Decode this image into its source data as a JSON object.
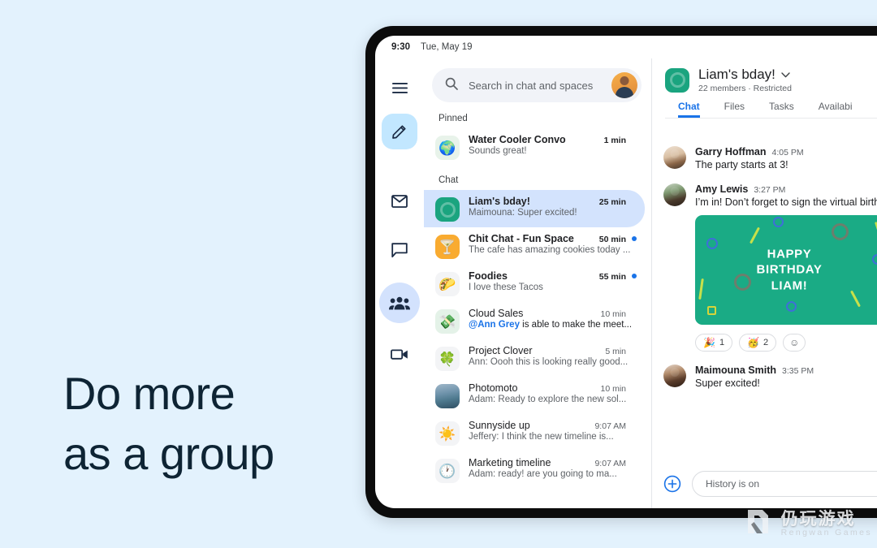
{
  "marketing": {
    "headline_line1": "Do more",
    "headline_line2": "as a group",
    "bg_color": "#e3f2fd",
    "text_color": "#0e2434"
  },
  "statusbar": {
    "time": "9:30",
    "date": "Tue, May 19"
  },
  "rail": {
    "items": [
      {
        "icon": "hamburger-menu-icon",
        "label": "Main menu"
      },
      {
        "icon": "compose-pencil-icon",
        "label": "Compose",
        "active": true
      },
      {
        "icon": "mail-icon",
        "label": "Mail"
      },
      {
        "icon": "chat-bubble-icon",
        "label": "Chat"
      },
      {
        "icon": "spaces-people-icon",
        "label": "Spaces",
        "active": true
      },
      {
        "icon": "video-camera-icon",
        "label": "Meet"
      }
    ]
  },
  "search": {
    "placeholder": "Search in chat and spaces",
    "icon": "search-icon",
    "avatar": "user-account-avatar"
  },
  "list": {
    "pinned_label": "Pinned",
    "chat_label": "Chat",
    "pinned": [
      {
        "avatar": "globe-emoji",
        "avatar_emoji": "🌍",
        "avatar_style": "globe",
        "name": "Water Cooler Convo",
        "preview": "Sounds great!",
        "time": "1 min",
        "bold": true,
        "unread": false
      }
    ],
    "chats": [
      {
        "avatar": "space-teal-icon",
        "avatar_emoji": "",
        "avatar_style": "teal",
        "name": "Liam's bday!",
        "preview": "Maimouna: Super excited!",
        "time": "25 min",
        "bold": true,
        "unread": false,
        "selected": true
      },
      {
        "avatar": "cocktail-emoji",
        "avatar_emoji": "🍸",
        "avatar_style": "amber",
        "name": "Chit Chat - Fun Space",
        "preview": "The cafe has amazing cookies today ...",
        "time": "50 min",
        "bold": true,
        "unread": true
      },
      {
        "avatar": "taco-emoji",
        "avatar_emoji": "🌮",
        "avatar_style": "plain",
        "name": "Foodies",
        "preview": "I love these Tacos",
        "time": "55 min",
        "bold": true,
        "unread": true
      },
      {
        "avatar": "money-emoji",
        "avatar_emoji": "💸",
        "avatar_style": "mint",
        "name": "Cloud Sales",
        "preview_mention": "@Ann Grey",
        "preview": " is able to make the meet...",
        "time": "10 min",
        "bold": false,
        "unread": false
      },
      {
        "avatar": "clover-emoji",
        "avatar_emoji": "🍀",
        "avatar_style": "plain",
        "name": "Project Clover",
        "preview": "Ann: Oooh this is looking really good...",
        "time": "5 min",
        "bold": false,
        "unread": false
      },
      {
        "avatar": "landscape-photo",
        "avatar_emoji": "",
        "avatar_style": "photo",
        "name": "Photomoto",
        "preview": "Adam: Ready to explore the new sol...",
        "time": "10 min",
        "bold": false,
        "unread": false
      },
      {
        "avatar": "sun-emoji",
        "avatar_emoji": "☀️",
        "avatar_style": "plain",
        "name": "Sunnyside up",
        "preview": "Jeffery: I think the new timeline is...",
        "time": "9:07 AM",
        "bold": false,
        "unread": false
      },
      {
        "avatar": "clock-emoji",
        "avatar_emoji": "🕐",
        "avatar_style": "plain",
        "name": "Marketing timeline",
        "preview": "Adam: ready! are you going to ma...",
        "time": "9:07 AM",
        "bold": false,
        "unread": false
      }
    ]
  },
  "conversation": {
    "title": "Liam's bday!",
    "dropdown_icon": "chevron-down-icon",
    "subtitle": "22 members · Restricted",
    "avatar": "space-teal-icon",
    "tabs": [
      {
        "label": "Chat",
        "active": true
      },
      {
        "label": "Files",
        "active": false
      },
      {
        "label": "Tasks",
        "active": false
      },
      {
        "label": "Availabi",
        "active": false
      }
    ],
    "messages": [
      {
        "author": "Garry Hoffman",
        "time": "4:05 PM",
        "text": "The party starts at 3!",
        "avatar": "garry-hoffman-avatar",
        "avatar_style": "a"
      },
      {
        "author": "Amy Lewis",
        "time": "3:27 PM",
        "text": "I’m in! Don’t forget to sign the virtual birth",
        "avatar": "amy-lewis-avatar",
        "avatar_style": "b",
        "card": {
          "text": "HAPPY\nBIRTHDAY\nLIAM!",
          "bg_color": "#1aab85"
        },
        "reactions": [
          {
            "emoji": "🎉",
            "count": "1",
            "name": "party-popper-reaction"
          },
          {
            "emoji": "🥳",
            "count": "2",
            "name": "partying-face-reaction"
          },
          {
            "emoji": "☺",
            "count": "",
            "name": "add-reaction-icon"
          }
        ]
      },
      {
        "author": "Maimouna Smith",
        "time": "3:35 PM",
        "text": "Super excited!",
        "avatar": "maimouna-smith-avatar",
        "avatar_style": "c"
      }
    ],
    "composer": {
      "placeholder": "History is on",
      "plus_icon": "add-plus-icon"
    }
  },
  "watermark": {
    "cn": "仍玩游戏",
    "en": "Rengwan Games",
    "logo": "rengwan-games-logo"
  }
}
